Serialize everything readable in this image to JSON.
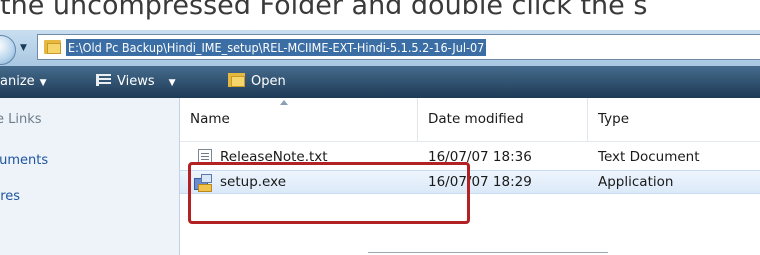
{
  "caption": "the uncompressed Folder and double click the s",
  "address_bar": {
    "path": "E:\\Old Pc Backup\\Hindi_IME_setup\\REL-MCIIME-EXT-Hindi-5.1.5.2-16-Jul-07"
  },
  "toolbar": {
    "organize_label": "anize",
    "views_label": "Views",
    "open_label": "Open"
  },
  "nav_pane": {
    "heading": "e Links",
    "items": [
      "cuments",
      "ures"
    ]
  },
  "file_list": {
    "columns": [
      "Name",
      "Date modified",
      "Type"
    ],
    "rows": [
      {
        "name": "ReleaseNote.txt",
        "date": "16/07/07 18:36",
        "type": "Text Document",
        "icon": "text-file-icon"
      },
      {
        "name": "setup.exe",
        "date": "16/07/07 18:29",
        "type": "Application",
        "icon": "setup-exe-icon"
      }
    ],
    "selected_row": 1
  },
  "colors": {
    "toolbar": "#1e3a56",
    "selection_highlight": "#3a6ea5",
    "annotation_box": "#b22222"
  }
}
